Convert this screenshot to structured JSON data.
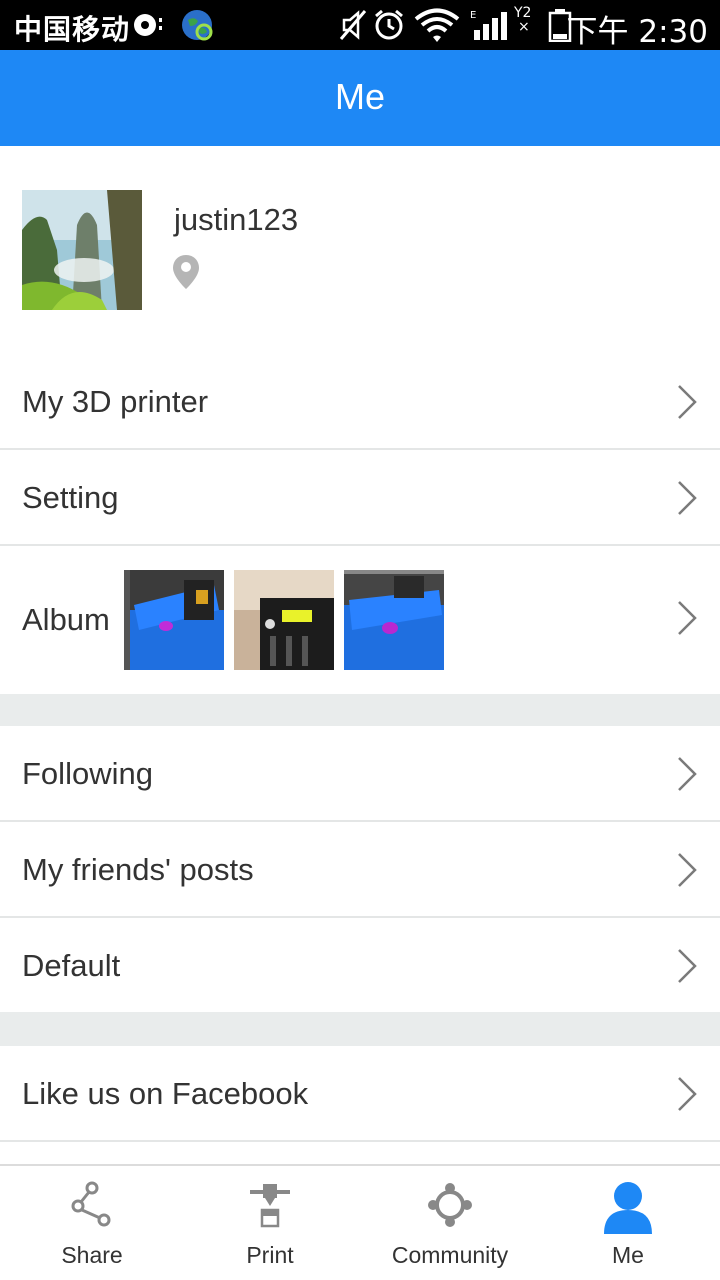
{
  "status_bar": {
    "carrier": "中国移动",
    "network_small": "Y2",
    "time": "下午 2:30"
  },
  "header": {
    "title": "Me"
  },
  "profile": {
    "username": "justin123"
  },
  "menu": {
    "my_printer": "My 3D printer",
    "setting": "Setting",
    "album": "Album",
    "following": "Following",
    "friends_posts": "My friends' posts",
    "default": "Default",
    "facebook": "Like us on Facebook"
  },
  "bottom_nav": {
    "items": [
      {
        "label": "Share",
        "icon": "share-icon"
      },
      {
        "label": "Print",
        "icon": "printer-nozzle-icon"
      },
      {
        "label": "Community",
        "icon": "community-icon"
      },
      {
        "label": "Me",
        "icon": "person-icon"
      }
    ],
    "active_index": 3
  },
  "colors": {
    "accent": "#1e88f5",
    "divider": "#e4e6e6",
    "gap": "#e9ecec",
    "text": "#333333"
  }
}
